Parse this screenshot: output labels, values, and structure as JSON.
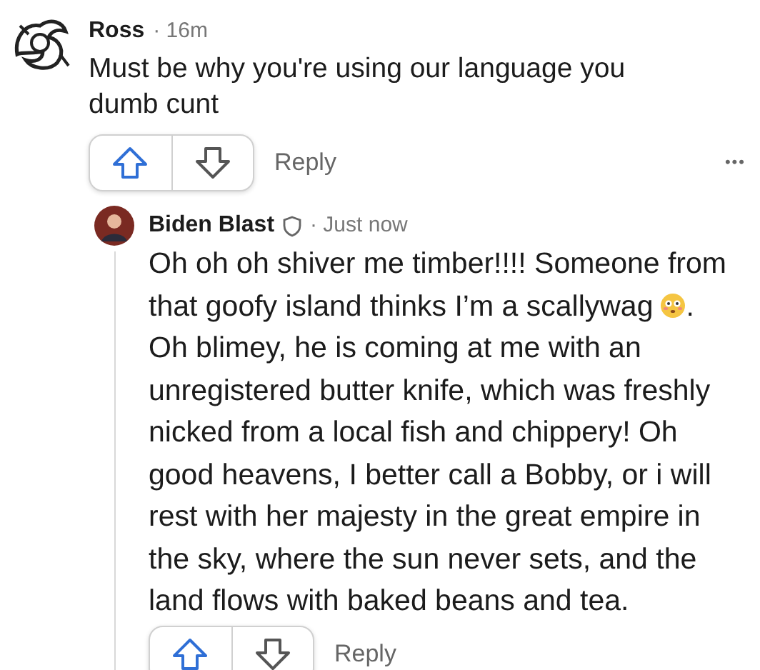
{
  "comments": [
    {
      "author": "Ross",
      "meta": "· 16m",
      "badge": false,
      "lines": [
        {
          "text": "Must be why you're using our language you"
        },
        {
          "text": "dumb cunt"
        }
      ],
      "actions": {
        "reply": "Reply",
        "more": "•••"
      }
    },
    {
      "author": "Biden Blast",
      "meta": "· Just now",
      "badge": true,
      "lines": [
        {
          "text": "Oh oh oh shiver me timber!!!! Someone from"
        },
        {
          "text": "that goofy island thinks I’m a scallywag",
          "kind": "emoji",
          "tail": "."
        },
        {
          "text": "Oh blimey, he is coming at me with an"
        },
        {
          "text": "unregistered butter knife, which was freshly"
        },
        {
          "text": "nicked from a local fish and chippery! Oh"
        },
        {
          "text": "good heavens, I better call a Bobby, or i will"
        },
        {
          "text": "rest with her majesty in the great empire in"
        },
        {
          "text": "the sky, where the sun never sets, and the"
        },
        {
          "text": "land flows with baked beans and tea."
        }
      ],
      "actions": {
        "reply": "Reply"
      }
    }
  ]
}
